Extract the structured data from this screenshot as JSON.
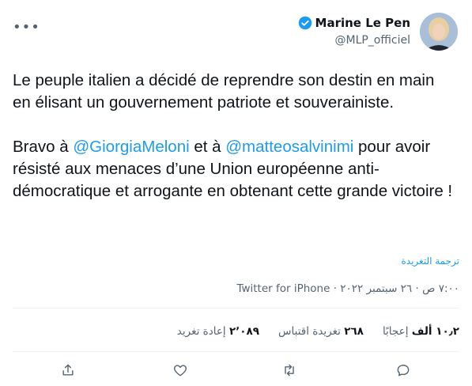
{
  "author": {
    "display_name": "Marine Le Pen",
    "handle": "@MLP_officiel"
  },
  "tweet": {
    "paragraph1": "Le peuple italien a décidé de reprendre son destin en main en élisant un gouvernement patriote et souverainiste.",
    "p2_part1": "Bravo à ",
    "mention1": "@GiorgiaMeloni",
    "p2_part2": " et à ",
    "mention2": "@matteosalvinimi",
    "p2_part3": " pour avoir résisté aux menaces d’une Union européenne anti-démocratique et arrogante en obtenant cette grande victoire !"
  },
  "translate_label": "ترجمة التغريدة",
  "meta": {
    "time": "٧:٠٠ ص",
    "separator": " · ",
    "date": "٢٦ سبتمبر ٢٠٢٢",
    "source": "Twitter for iPhone"
  },
  "stats": [
    {
      "count": "٢٬٠٨٩",
      "label": "إعادة تغريد"
    },
    {
      "count": "٢٦٨",
      "label": "تغريدة اقتباس"
    },
    {
      "count": "١٠٫٢ ألف",
      "label": "إعجابًا"
    }
  ],
  "icons": {
    "more": "more-horizontal-icon",
    "verified": "verified-badge-icon",
    "reply": "reply-icon",
    "retweet": "retweet-icon",
    "like": "heart-icon",
    "share": "share-icon"
  },
  "colors": {
    "accent": "#1d9bf0",
    "text": "#0f1419",
    "secondary": "#536471",
    "divider": "#eff3f4"
  }
}
